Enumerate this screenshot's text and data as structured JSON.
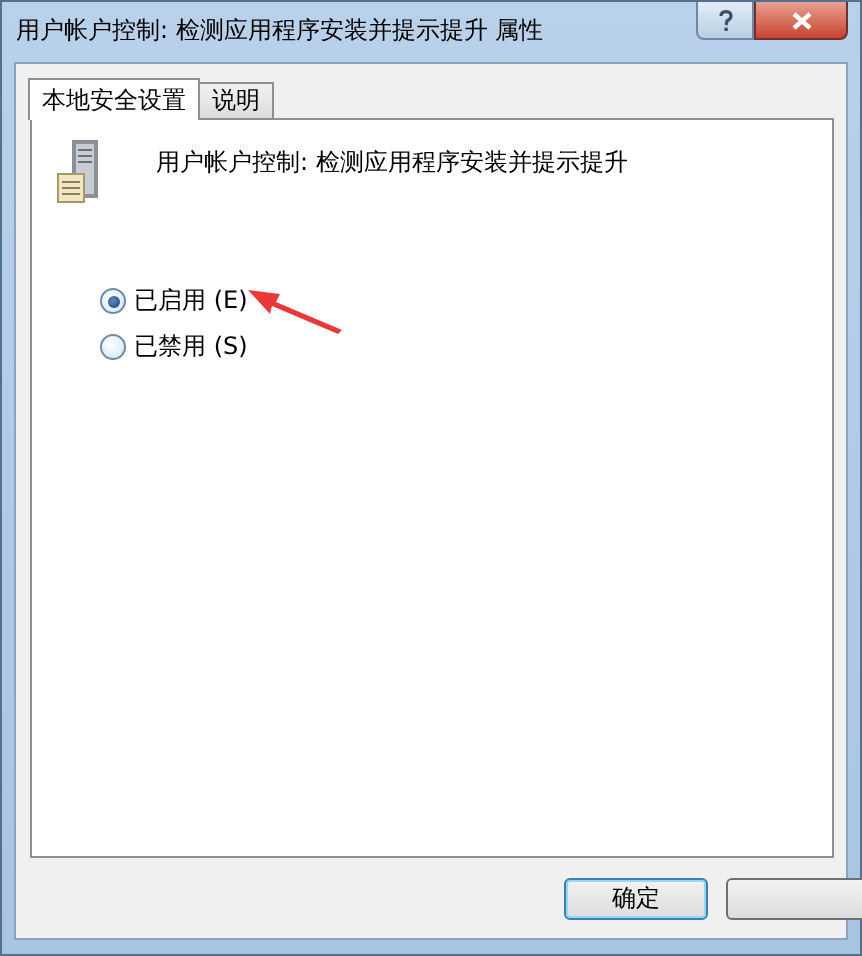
{
  "window": {
    "title": "用户帐户控制: 检测应用程序安装并提示提升 属性"
  },
  "tabs": [
    {
      "label": "本地安全设置",
      "selected": true
    },
    {
      "label": "说明",
      "selected": false
    }
  ],
  "policy": {
    "title": "用户帐户控制: 检测应用程序安装并提示提升"
  },
  "options": [
    {
      "label": "已启用 (E)",
      "selected": true
    },
    {
      "label": "已禁用 (S)",
      "selected": false
    }
  ],
  "annotations": [
    {
      "kind": "arrow"
    }
  ],
  "buttons": [
    {
      "kind": "default",
      "label": "确定"
    },
    {
      "kind": "plain"
    }
  ]
}
